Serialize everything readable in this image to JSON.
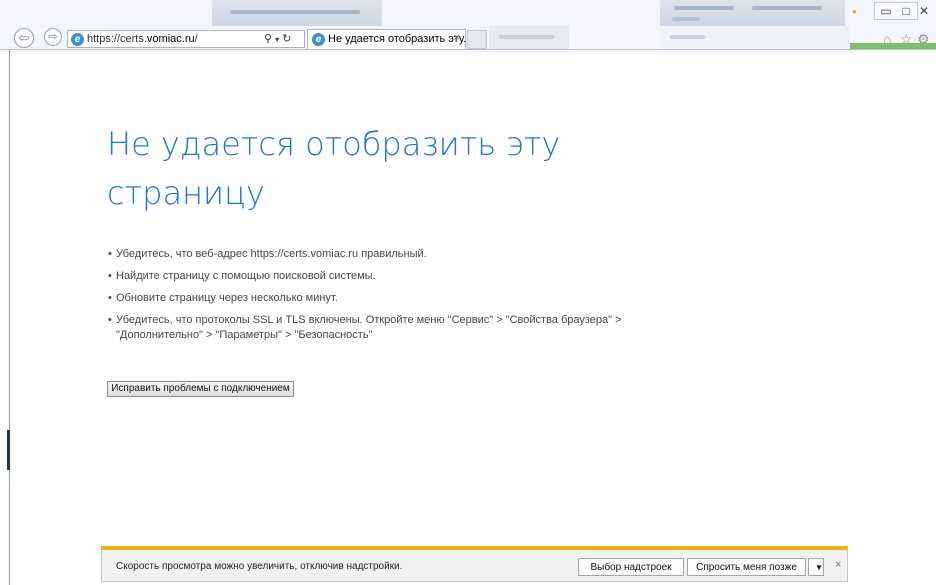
{
  "browser": {
    "address_url_prefix": "https://certs.",
    "address_url_domain": "vomiac.ru",
    "address_url_suffix": "/",
    "search_icon": "search-icon",
    "refresh_icon": "refresh-icon",
    "tab_title": "Не удается отобразить эту...",
    "tab_close": "×",
    "window": {
      "minimize": "▭",
      "maximize": "□",
      "close": "✕"
    },
    "toolbar_icons": [
      "home-icon",
      "favorites-star-icon",
      "settings-gear-icon"
    ]
  },
  "page": {
    "heading": "Не удается отобразить эту страницу",
    "bullets": [
      "Убедитесь, что веб-адрес https://certs.vomiac.ru правильный.",
      "Найдите страницу с помощью поисковой системы.",
      "Обновите страницу через несколько минут.",
      "Убедитесь, что протоколы SSL и TLS включены. Откройте меню \"Сервис\" > \"Свойства браузера\" > \"Дополнительно\" > \"Параметры\" > \"Безопасность\""
    ],
    "fix_button": "Исправить проблемы с подключением"
  },
  "notification": {
    "text": "Скорость просмотра можно увеличить, отключив надстройки.",
    "choose_addons": "Выбор надстроек",
    "ask_later": "Спросить меня позже",
    "dropdown": "▼",
    "close": "×"
  },
  "colors": {
    "heading": "#1e73d6",
    "notification_accent": "#eeb311"
  }
}
